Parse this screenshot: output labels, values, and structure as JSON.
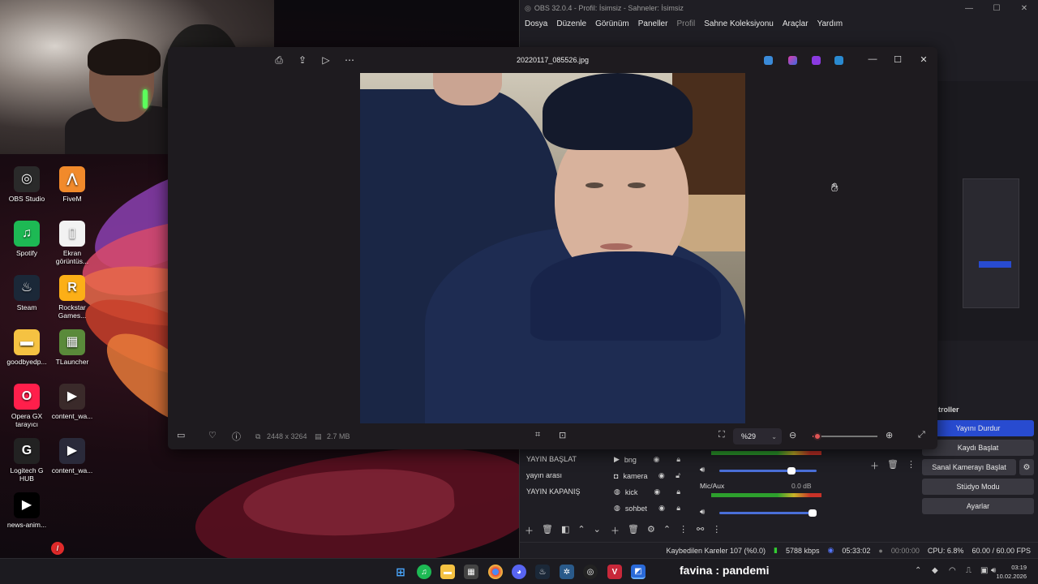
{
  "desktop": {
    "icons": [
      {
        "label": "OBS Studio",
        "icon": "obs-icon",
        "color": "#2a2a2a"
      },
      {
        "label": "FiveM",
        "icon": "fivem-icon",
        "color": "#f18a2b"
      },
      {
        "label": "Spotify",
        "icon": "spotify-icon",
        "color": "#1db954"
      },
      {
        "label": "Ekran görüntüs...",
        "icon": "document-icon",
        "color": "#f2f2f2"
      },
      {
        "label": "Steam",
        "icon": "steam-icon",
        "color": "#1b2838"
      },
      {
        "label": "Rockstar Games...",
        "icon": "rockstar-icon",
        "color": "#fcaf17"
      },
      {
        "label": "goodbyedp...",
        "icon": "folder-icon",
        "color": "#f5c242"
      },
      {
        "label": "TLauncher",
        "icon": "tlauncher-icon",
        "color": "#5a8a3a"
      },
      {
        "label": "Opera GX tarayıcı",
        "icon": "opera-gx-icon",
        "color": "#ff1f4b"
      },
      {
        "label": "content_wa...",
        "icon": "video-icon",
        "color": "#3a2a2a"
      },
      {
        "label": "Logitech G HUB",
        "icon": "logitech-icon",
        "color": "#222"
      },
      {
        "label": "content_wa...",
        "icon": "video-icon",
        "color": "#2a2a3a"
      },
      {
        "label": "news-anim...",
        "icon": "video-icon",
        "color": "#000"
      }
    ]
  },
  "obs": {
    "title": "OBS 32.0.4 - Profil: İsimsiz - Sahneler: İsimsiz",
    "menu": [
      "Dosya",
      "Düzenle",
      "Görünüm",
      "Paneller",
      "Profil",
      "Sahne Koleksiyonu",
      "Araçlar",
      "Yardım"
    ],
    "scenes": [
      "YAYIN BAŞLAT",
      "yayın arası",
      "YAYIN KAPANIŞ"
    ],
    "sources": [
      "bng",
      "kamera",
      "kick",
      "sohbet"
    ],
    "mixer": {
      "mic_label": "Mic/Aux",
      "mic_db": "0.0 dB"
    },
    "controls_title": "troller",
    "controls": [
      "Yayını Durdur",
      "Kaydı Başlat",
      "Sanal Kamerayı Başlat",
      "Stüdyo Modu",
      "Ayarlar"
    ],
    "status": {
      "dropped": "Kaybedilen Kareler 107 (%0.0)",
      "bitrate": "5788 kbps",
      "stream_time": "05:33:02",
      "rec_time": "00:00:00",
      "cpu": "CPU: 6.8%",
      "fps": "60.00 / 60.00 FPS"
    }
  },
  "viewer": {
    "filename": "20220117_085526.jpg",
    "dimensions": "2448 x 3264",
    "size": "2.7 MB",
    "zoom": "%29",
    "zoom_level": 0.08
  },
  "taskbar": {
    "chat_user": "favina",
    "chat_message": ": pandemi",
    "time": "03:19",
    "date": "10.02.2026"
  },
  "colors": {
    "accent": "#284bd0",
    "zoom": "#e05555"
  }
}
